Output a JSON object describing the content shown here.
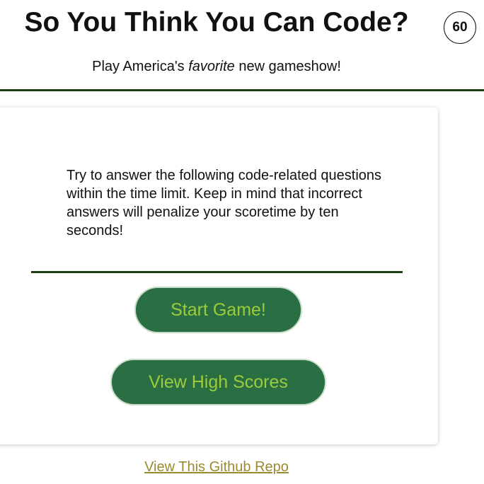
{
  "header": {
    "title": "So You Think You Can Code?",
    "timer": "60",
    "subtitle_pre": "Play America's ",
    "subtitle_em": "favorite",
    "subtitle_post": " new gameshow!"
  },
  "card": {
    "instructions": "Try to answer the following code-related questions within the time limit. Keep in mind that incorrect answers will penalize your scoretime by ten seconds!",
    "start_button": "Start Game!",
    "high_scores_button": "View High Scores"
  },
  "footer": {
    "repo_link": "View This Github Repo"
  },
  "colors": {
    "accent_dark_green": "#1f3d12",
    "button_bg": "#2a6e43",
    "button_text": "#9ccc3c",
    "link": "#9b8a2e"
  }
}
